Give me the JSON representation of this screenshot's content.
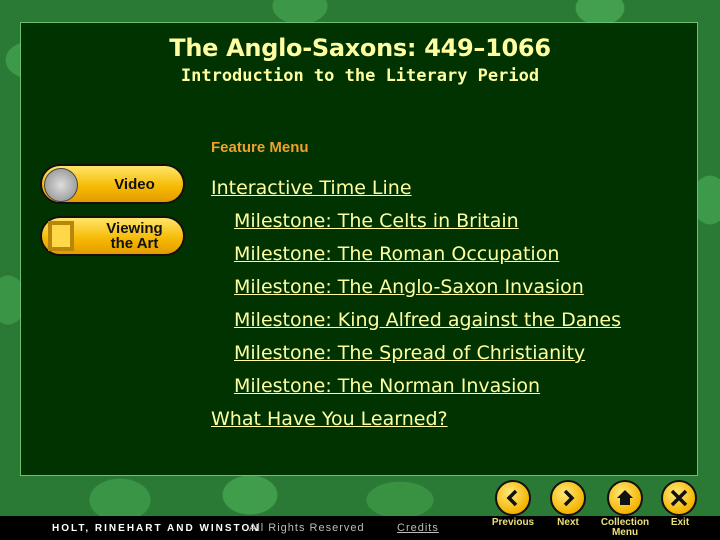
{
  "header": {
    "title": "The Anglo-Saxons: 449–1066",
    "subtitle": "Introduction to the Literary Period"
  },
  "feature_menu": {
    "heading": "Feature Menu",
    "items": [
      {
        "label": "Interactive Time Line",
        "indent": false
      },
      {
        "label": "Milestone: The Celts in Britain",
        "indent": true
      },
      {
        "label": "Milestone: The Roman Occupation",
        "indent": true
      },
      {
        "label": "Milestone: The Anglo-Saxon Invasion",
        "indent": true
      },
      {
        "label": "Milestone: King Alfred against the Danes",
        "indent": true
      },
      {
        "label": "Milestone: The Spread of Christianity",
        "indent": true
      },
      {
        "label": "Milestone: The Norman Invasion",
        "indent": true
      },
      {
        "label": "What Have You Learned?",
        "indent": false
      }
    ]
  },
  "side_buttons": {
    "video": {
      "label": "Video",
      "icon": "film-reel-icon"
    },
    "art": {
      "label": "Viewing the Art",
      "icon": "picture-frame-icon"
    }
  },
  "footer": {
    "brand": "HOLT, RINEHART AND WINSTON",
    "rights": "All Rights Reserved",
    "credits": "Credits"
  },
  "nav": {
    "previous": {
      "label": "Previous",
      "icon": "chevron-left-icon"
    },
    "next": {
      "label": "Next",
      "icon": "chevron-right-icon"
    },
    "collection": {
      "label": "Collection Menu",
      "icon": "home-icon"
    },
    "exit": {
      "label": "Exit",
      "icon": "close-icon"
    }
  },
  "colors": {
    "panel_bg": "#013300",
    "text_yellow": "#fffea0",
    "heading_orange": "#f0a12a",
    "button_gold": "#f5b800"
  }
}
